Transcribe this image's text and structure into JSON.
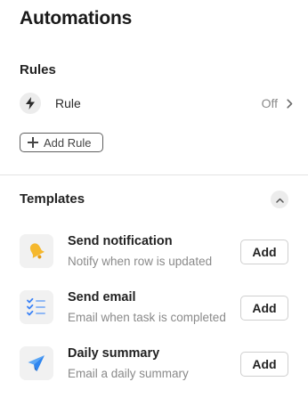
{
  "page": {
    "title": "Automations"
  },
  "rules": {
    "label": "Rules",
    "items": [
      {
        "name": "Rule",
        "status": "Off",
        "icon": "lightning-bolt-icon"
      }
    ],
    "add_label": "Add Rule"
  },
  "templates": {
    "label": "Templates",
    "collapse_icon": "chevron-up-icon",
    "items": [
      {
        "title": "Send notification",
        "description": "Notify when row is updated",
        "action": "Add",
        "icon": "bell-icon",
        "icon_color": "#f5b82e"
      },
      {
        "title": "Send email",
        "description": "Email when task is completed",
        "action": "Add",
        "icon": "checklist-icon",
        "icon_color": "#3b82f6"
      },
      {
        "title": "Daily summary",
        "description": "Email a daily summary",
        "action": "Add",
        "icon": "paper-plane-icon",
        "icon_color": "#2f86f0"
      }
    ]
  }
}
